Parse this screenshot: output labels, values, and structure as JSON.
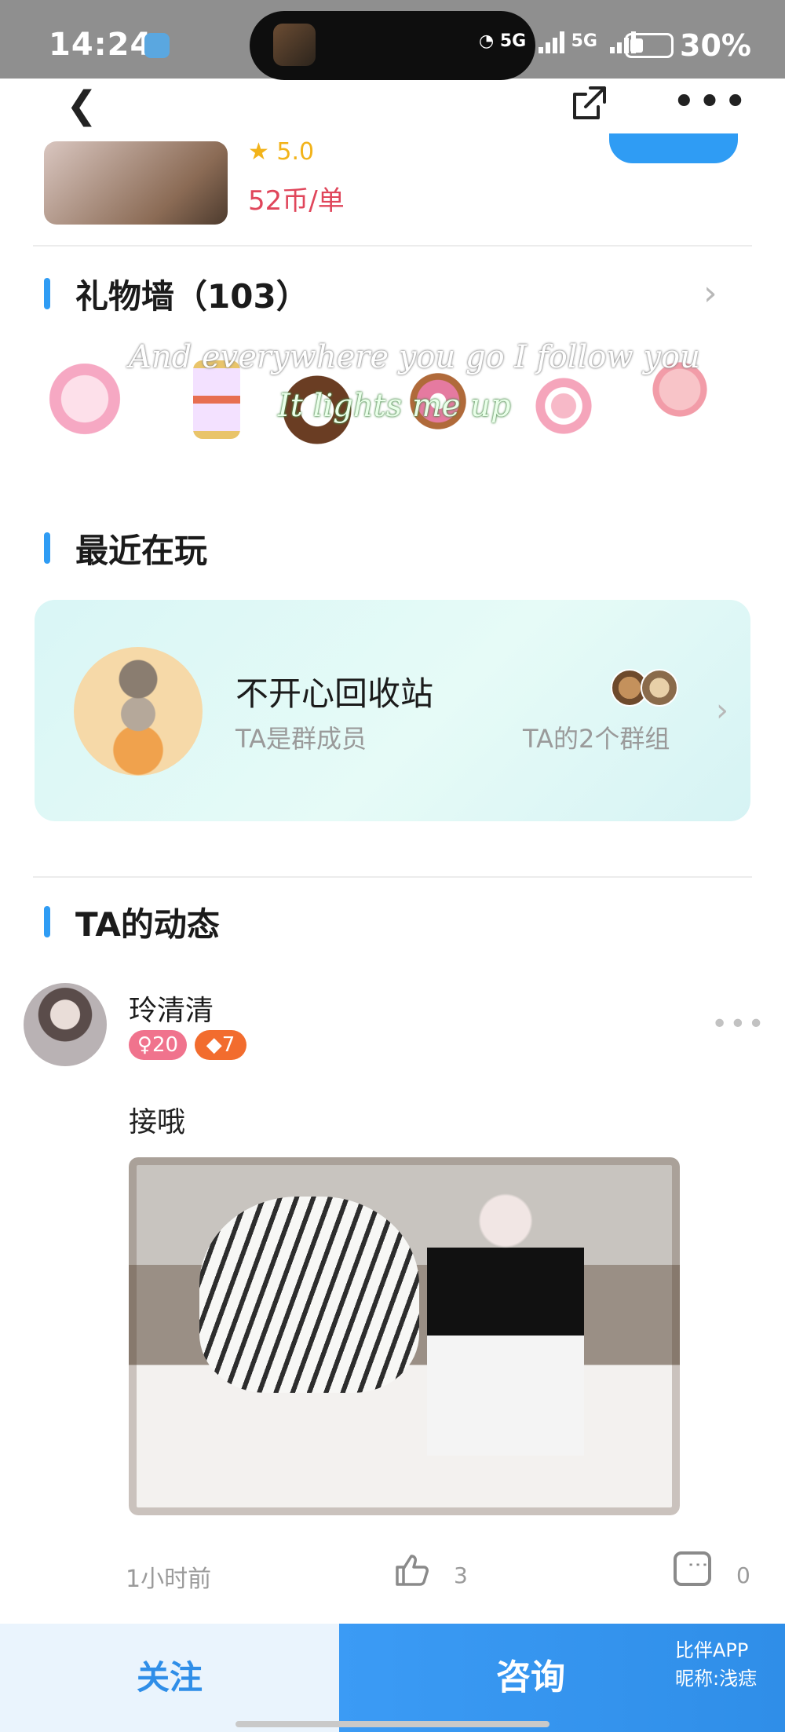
{
  "status_bar": {
    "time": "14:24",
    "network_1": "5G",
    "network_2": "5G",
    "battery": "30%"
  },
  "nav": {
    "back_icon": "chevron-left-icon",
    "share_icon": "share-icon",
    "more_icon": "more-dots-icon"
  },
  "service": {
    "rating": "★ 5.0",
    "price": "52币/单"
  },
  "gift_wall": {
    "title": "礼物墙（103）",
    "lyric_line_1": "And everywhere you go I follow you",
    "lyric_line_2": "It lights me up"
  },
  "recently_playing": {
    "title": "最近在玩",
    "group_name": "不开心回收站",
    "role": "TA是群成员",
    "groups_count": "TA的2个群组"
  },
  "posts": {
    "title": "TA的动态",
    "author": "玲清清",
    "gender_age": "♀20",
    "level": "◆7",
    "text": "接哦",
    "time": "1小时前",
    "like_count": "3",
    "comment_count": "0"
  },
  "bottom_bar": {
    "follow": "关注",
    "consult": "咨询",
    "watermark_app": "比伴APP",
    "watermark_nick": "昵称:浅痣"
  },
  "colors": {
    "accent": "#2f9cf4",
    "price": "#e0465b",
    "star": "#f2b31a"
  }
}
